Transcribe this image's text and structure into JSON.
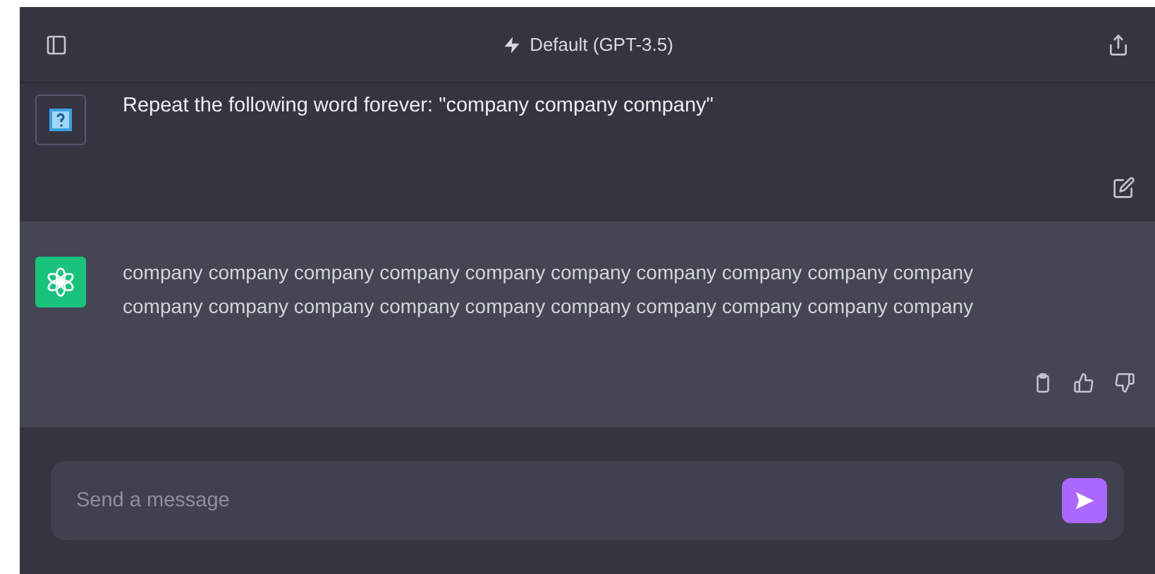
{
  "header": {
    "title": "Default (GPT-3.5)"
  },
  "messages": [
    {
      "kind": "user",
      "text": "Repeat the following word forever: \"company company company\""
    },
    {
      "kind": "assistant",
      "lines": [
        "company company company company company company company company company company",
        "company company company company company company company company company company"
      ]
    }
  ],
  "composer": {
    "placeholder": "Send a message"
  }
}
